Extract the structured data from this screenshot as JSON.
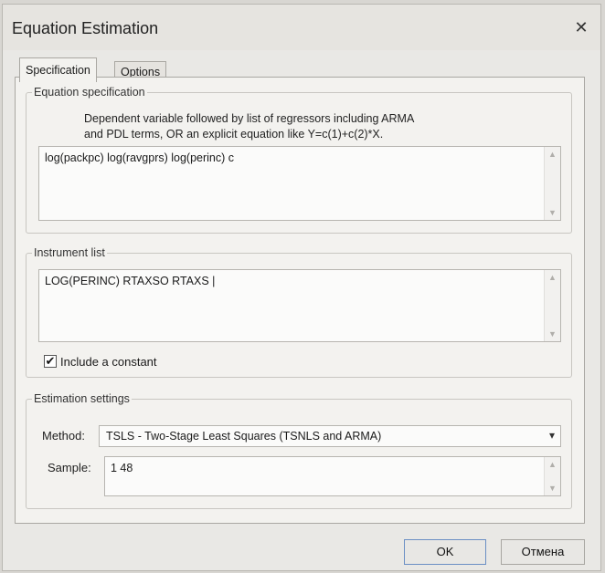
{
  "window": {
    "title": "Equation Estimation"
  },
  "tabs": [
    {
      "label": "Specification",
      "active": true
    },
    {
      "label": "Options",
      "active": false
    }
  ],
  "equation_spec": {
    "legend": "Equation specification",
    "description_line1": "Dependent variable followed by list of regressors including ARMA",
    "description_line2": "and PDL terms, OR an explicit equation like Y=c(1)+c(2)*X.",
    "value": "log(packpc) log(ravgprs) log(perinc) c"
  },
  "instrument_list": {
    "legend": "Instrument list",
    "value": "LOG(PERINC) RTAXSO RTAXS |",
    "include_constant_label": "Include a constant",
    "include_constant_checked": true
  },
  "estimation_settings": {
    "legend": "Estimation settings",
    "method_label": "Method:",
    "method_value": "TSLS  -  Two-Stage Least Squares (TSNLS and ARMA)",
    "sample_label": "Sample:",
    "sample_value": "1 48"
  },
  "buttons": {
    "ok": "OK",
    "cancel": "Отмена"
  },
  "icons": {
    "close": "close-icon",
    "scroll_up": "scroll-up-arrow-icon",
    "scroll_down": "scroll-down-arrow-icon",
    "dropdown": "chevron-down-icon",
    "check": "checkmark-icon"
  },
  "colors": {
    "ok_border": "#6b8fc4",
    "panel_bg": "#f3f2ef"
  }
}
